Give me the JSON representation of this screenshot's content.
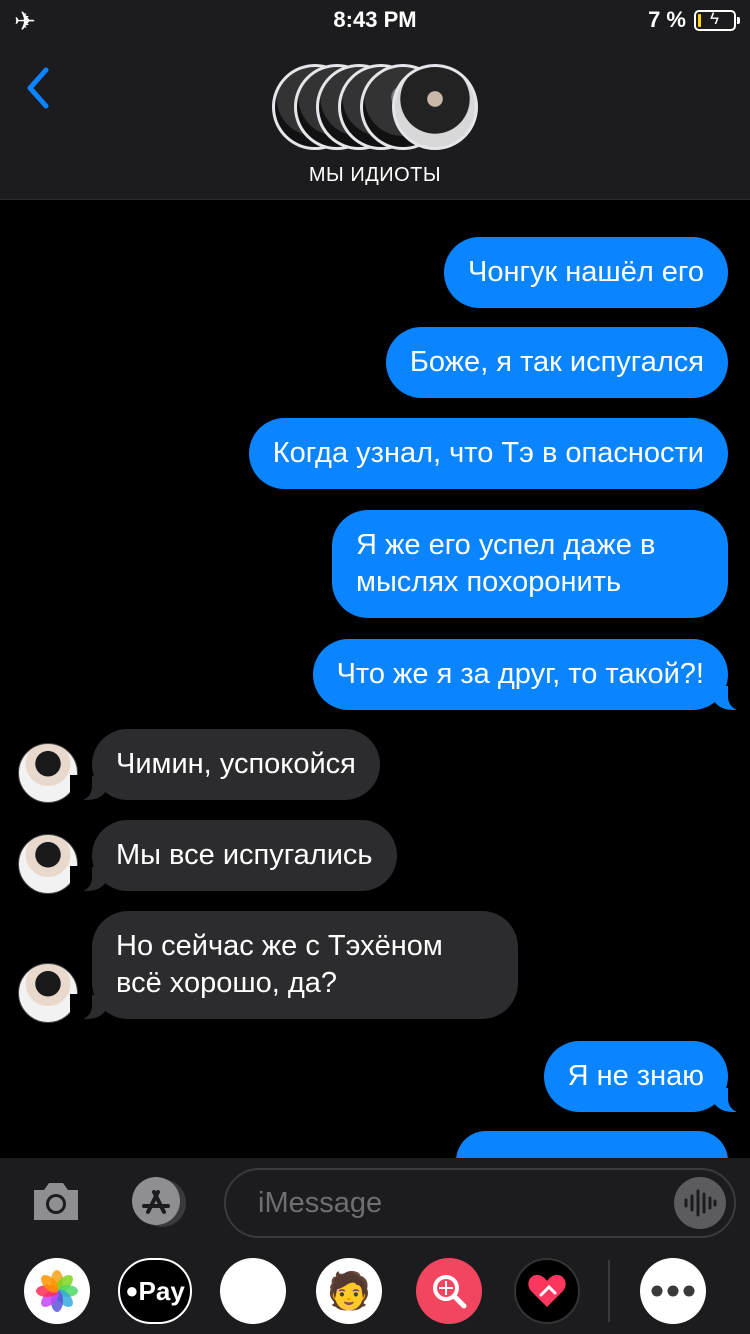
{
  "status_bar": {
    "time": "8:43 PM",
    "battery_percent": "7 %",
    "battery_level": 0.07,
    "airplane_icon": "airplane-icon",
    "accent": "#ffd60a"
  },
  "header": {
    "group_name": "МЫ ИДИОТЫ",
    "back_icon": "chevron-left-icon",
    "accent": "#0a84ff"
  },
  "messages": [
    {
      "direction": "outgoing",
      "text": "Чонгук нашёл его"
    },
    {
      "direction": "outgoing",
      "text": "Боже, я так испугался"
    },
    {
      "direction": "outgoing",
      "text": "Когда узнал, что Тэ в опасности"
    },
    {
      "direction": "outgoing",
      "text": "Я же его успел даже в мыслях похоронить"
    },
    {
      "direction": "outgoing",
      "text": "Что же я за друг, то такой?!"
    },
    {
      "direction": "incoming",
      "text": "Чимин, успокойся"
    },
    {
      "direction": "incoming",
      "text": "Мы все испугались"
    },
    {
      "direction": "incoming",
      "text": "Но сейчас же с Тэхёном всё хорошо, да?"
    },
    {
      "direction": "outgoing",
      "text": "Я не знаю"
    }
  ],
  "input": {
    "placeholder": "iMessage"
  },
  "app_drawer": {
    "pay_label": "Pay",
    "apps": [
      "photos-icon",
      "apple-pay-icon",
      "animoji-monkey-icon",
      "memoji-icon",
      "image-search-icon",
      "digital-touch-heart-icon",
      "more-icon"
    ]
  }
}
